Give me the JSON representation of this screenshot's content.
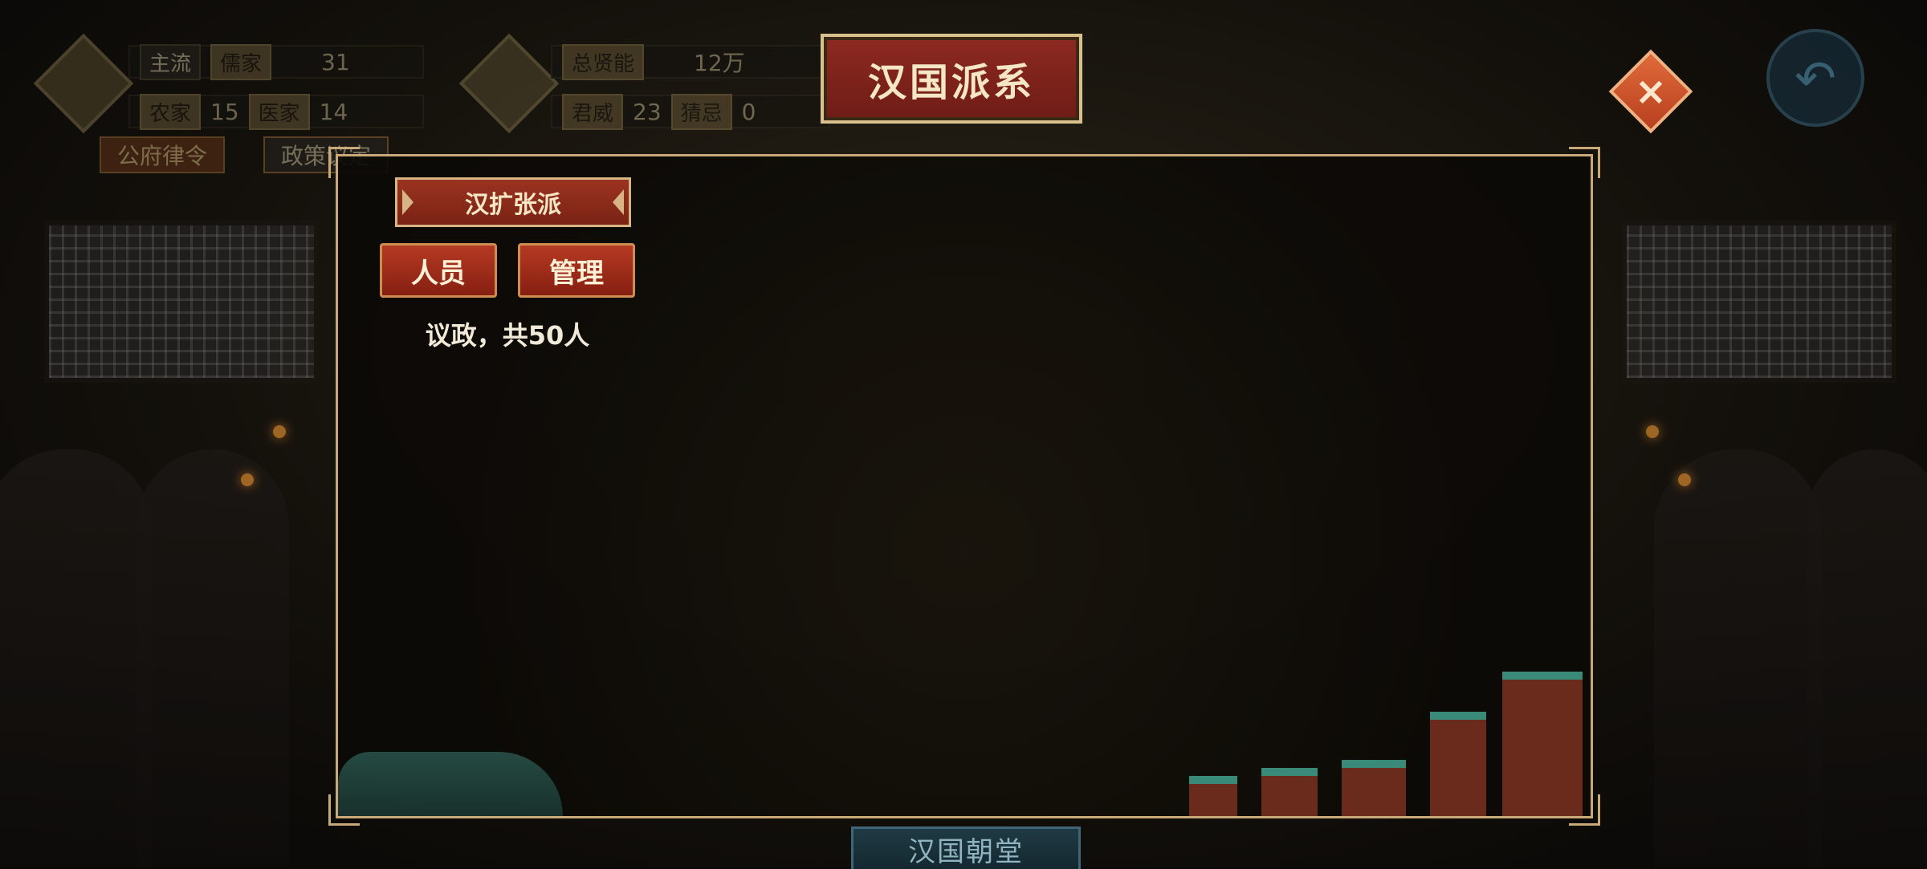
{
  "hud": {
    "stats_left": {
      "tag1": "主流",
      "tag2": "儒家",
      "value": "31",
      "tag3": "农家",
      "value2": "15",
      "tag4": "医家",
      "value3": "14"
    },
    "stats_right": {
      "tag1": "总贤能",
      "value": "12万",
      "tag2": "君威",
      "value2": "23",
      "tag3": "猜忌",
      "value3": "0"
    },
    "buttons": [
      "公府律令",
      "政策议定"
    ]
  },
  "title": "汉国派系",
  "close_icon": "×",
  "back_icon": "↶",
  "panel": {
    "faction_name": "汉扩张派",
    "personnel_label": "人员",
    "manage_label": "管理",
    "info": "议政，共50人"
  },
  "bottom_label": "汉国朝堂",
  "colors": {
    "banner_red": "#8d2a21",
    "gold_border": "#c9a978",
    "close_orange": "#e06a3a"
  }
}
